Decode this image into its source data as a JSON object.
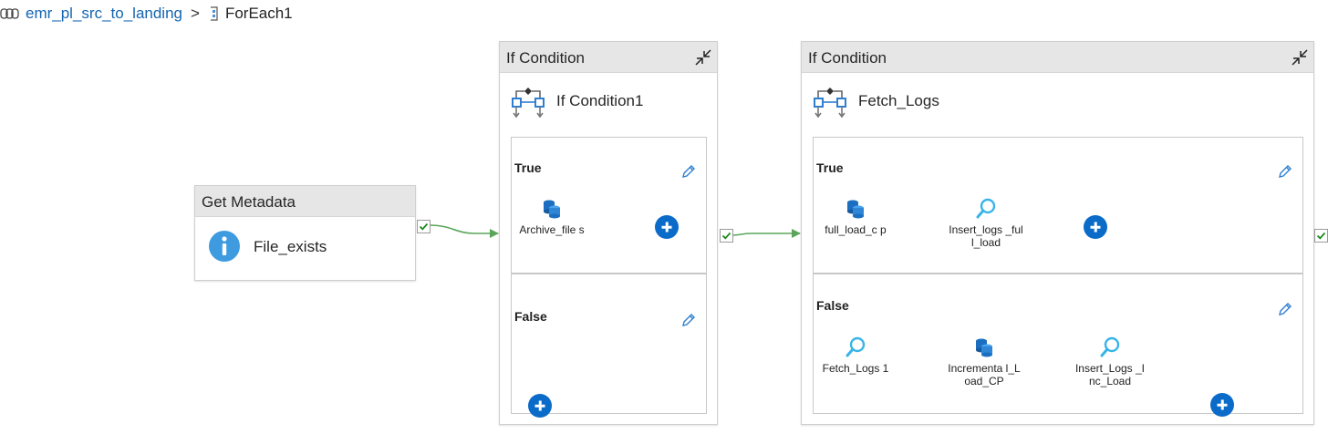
{
  "breadcrumb": {
    "pipeline": "emr_pl_src_to_landing",
    "separator": ">",
    "current": "ForEach1"
  },
  "get_metadata": {
    "type_label": "Get Metadata",
    "name": "File_exists"
  },
  "if_condition_1": {
    "type_label": "If Condition",
    "name": "If Condition1",
    "true_branch": {
      "label": "True",
      "activities": [
        {
          "name": "Archive_files",
          "display": "Archive_file s",
          "icon": "copy-data-icon"
        }
      ]
    },
    "false_branch": {
      "label": "False",
      "activities": []
    }
  },
  "if_condition_2": {
    "type_label": "If Condition",
    "name": "Fetch_Logs",
    "true_branch": {
      "label": "True",
      "activities": [
        {
          "name": "full_load_cp",
          "display": "full_load_c p",
          "icon": "copy-data-icon"
        },
        {
          "name": "Insert_logs_full_load",
          "display": "Insert_logs _full_load",
          "icon": "lookup-icon"
        }
      ]
    },
    "false_branch": {
      "label": "False",
      "activities": [
        {
          "name": "Fetch_Logs1",
          "display": "Fetch_Logs 1",
          "icon": "lookup-icon"
        },
        {
          "name": "Incremental_Load_CP",
          "display": "Incrementa l_Load_CP",
          "icon": "copy-data-icon"
        },
        {
          "name": "Insert_Logs_Inc_Load",
          "display": "Insert_Logs _Inc_Load",
          "icon": "lookup-icon"
        }
      ]
    }
  },
  "colors": {
    "accent": "#0b6bc9",
    "success_arrow": "#1e8a1e",
    "header_bg": "#e6e6e6",
    "link": "#1565b0"
  }
}
